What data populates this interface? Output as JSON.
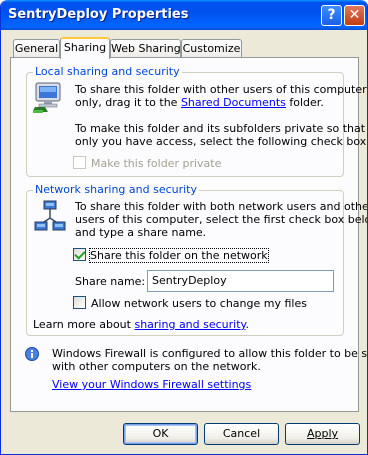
{
  "window": {
    "title": "SentryDeploy Properties",
    "help_glyph": "?",
    "close_glyph": "✕"
  },
  "tabs": [
    {
      "label": "General"
    },
    {
      "label": "Sharing"
    },
    {
      "label": "Web Sharing"
    },
    {
      "label": "Customize"
    }
  ],
  "local": {
    "legend": "Local sharing and security",
    "text1_line1": "To share this folder with other users of this computer",
    "text1_line2_pre": "only, drag it to the ",
    "text1_link": "Shared Documents",
    "text1_line2_post": " folder.",
    "text2_line1": "To make this folder and its subfolders private so that",
    "text2_line2": "only you have access, select the following check box.",
    "private_checkbox_label": "Make this folder private",
    "private_checked": false,
    "icon": "computer-sharing-icon"
  },
  "network": {
    "legend": "Network sharing and security",
    "text_line1": "To share this folder with both network users and other",
    "text_line2": "users of this computer, select the first check box below",
    "text_line3": "and type a share name.",
    "share_checkbox_label": "Share this folder on the network",
    "share_checked": true,
    "share_name_label": "Share name:",
    "share_name_value": "SentryDeploy",
    "allow_change_label": "Allow network users to change my files",
    "allow_change_checked": false,
    "learn_more_pre": "Learn more about ",
    "learn_more_link": "sharing and security",
    "learn_more_post": ".",
    "icon": "network-sharing-icon"
  },
  "firewall": {
    "line1": "Windows Firewall is configured to allow this folder to be shared",
    "line2": "with other computers on the network.",
    "link": "View your Windows Firewall settings",
    "icon": "info-icon"
  },
  "buttons": {
    "ok": "OK",
    "cancel": "Cancel",
    "apply": "Apply"
  },
  "colors": {
    "title_bar": "#0053ee",
    "group_legend": "#0046d5",
    "link": "#0000ff",
    "window_bg": "#ece9d8"
  }
}
